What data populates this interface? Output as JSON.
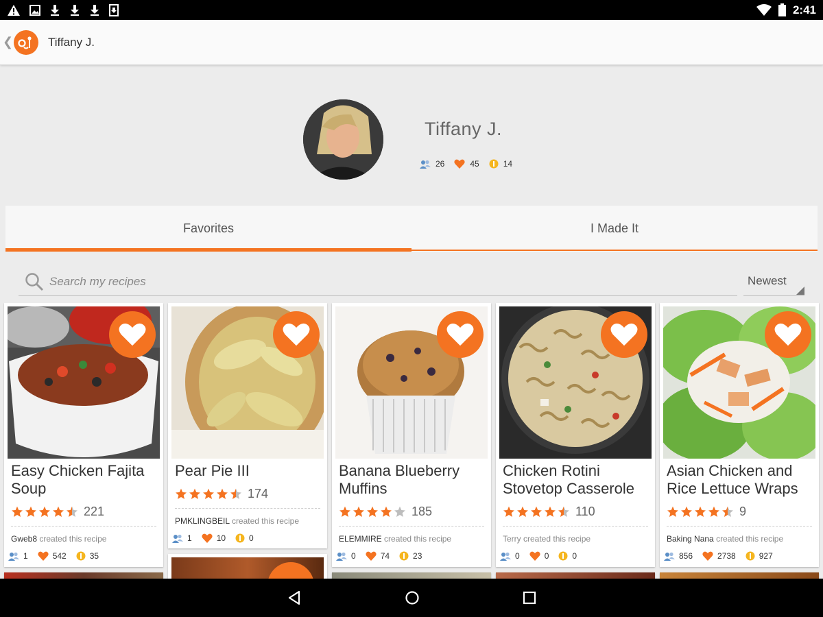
{
  "status_bar": {
    "time": "2:41"
  },
  "app_bar": {
    "title": "Tiffany J."
  },
  "profile": {
    "name": "Tiffany J.",
    "followers": "26",
    "favorites": "45",
    "made": "14"
  },
  "tabs": [
    {
      "label": "Favorites"
    },
    {
      "label": "I Made It"
    }
  ],
  "search": {
    "placeholder": "Search my recipes"
  },
  "sort": {
    "selected": "Newest"
  },
  "cards": [
    {
      "title": "Easy Chicken Fajita Soup",
      "rating": 4.5,
      "rating_count": "221",
      "creator": "Gweb8",
      "creator_suffix": "created this recipe",
      "followers": "1",
      "favorites": "542",
      "made": "35"
    },
    {
      "title": "Pear Pie III",
      "rating": 4.5,
      "rating_count": "174",
      "creator": "PMKLINGBEIL",
      "creator_suffix": "created this recipe",
      "followers": "1",
      "favorites": "10",
      "made": "0"
    },
    {
      "title": "Banana Blueberry Muffins",
      "rating": 4,
      "rating_count": "185",
      "creator": "ELEMMIRE",
      "creator_suffix": "created this recipe",
      "followers": "0",
      "favorites": "74",
      "made": "23"
    },
    {
      "title": "Chicken Rotini Stovetop Casserole",
      "rating": 4.5,
      "rating_count": "110",
      "creator": "",
      "creator_suffix": "Terry created this recipe",
      "followers": "0",
      "favorites": "0",
      "made": "0"
    },
    {
      "title": "Asian Chicken and Rice Lettuce Wraps",
      "rating": 4.5,
      "rating_count": "9",
      "creator": "Baking Nana",
      "creator_suffix": "created this recipe",
      "followers": "856",
      "favorites": "2738",
      "made": "927"
    }
  ],
  "colors": {
    "accent": "#f47321",
    "people_icon": "#5b8fc7",
    "made_icon": "#f5b51e"
  }
}
